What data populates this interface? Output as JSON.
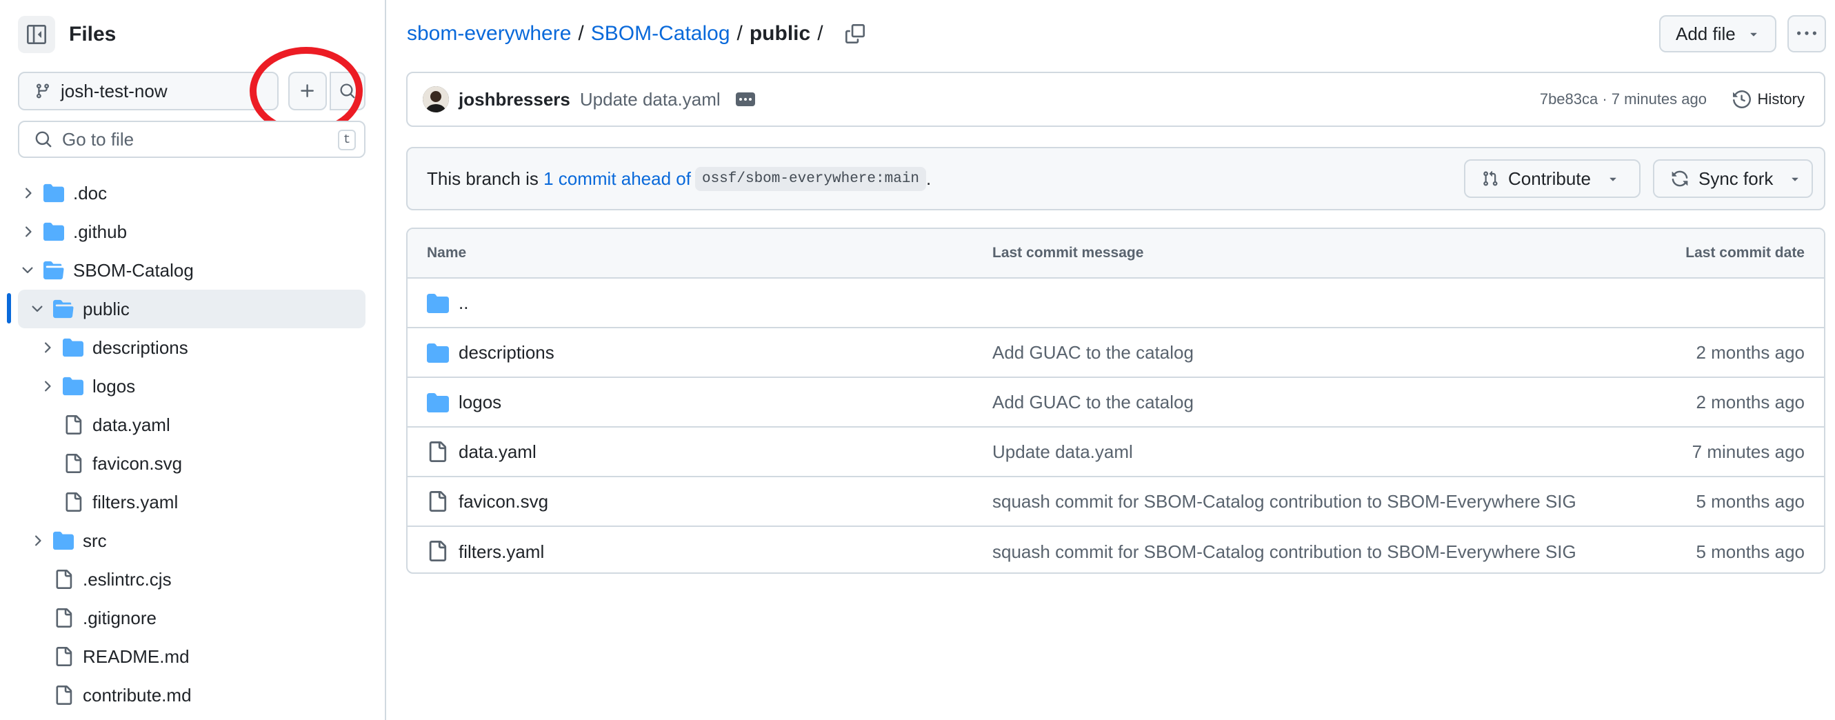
{
  "sidebar": {
    "title": "Files",
    "branch": "josh-test-now",
    "goto_placeholder": "Go to file",
    "goto_shortcut": "t",
    "tree": [
      {
        "label": ".doc",
        "type": "folder",
        "expanded": false
      },
      {
        "label": ".github",
        "type": "folder",
        "expanded": false
      },
      {
        "label": "SBOM-Catalog",
        "type": "folder",
        "expanded": true
      },
      {
        "label": "public",
        "type": "folder",
        "expanded": true,
        "active": true
      },
      {
        "label": "descriptions",
        "type": "folder",
        "expanded": false
      },
      {
        "label": "logos",
        "type": "folder",
        "expanded": false
      },
      {
        "label": "data.yaml",
        "type": "file"
      },
      {
        "label": "favicon.svg",
        "type": "file"
      },
      {
        "label": "filters.yaml",
        "type": "file"
      },
      {
        "label": "src",
        "type": "folder",
        "expanded": false
      },
      {
        "label": ".eslintrc.cjs",
        "type": "file"
      },
      {
        "label": ".gitignore",
        "type": "file"
      },
      {
        "label": "README.md",
        "type": "file"
      },
      {
        "label": "contribute.md",
        "type": "file"
      }
    ]
  },
  "breadcrumb": {
    "repo": "sbom-everywhere",
    "folder": "SBOM-Catalog",
    "current": "public",
    "sep": "/"
  },
  "toolbar": {
    "add_file": "Add file"
  },
  "commit": {
    "author": "joshbressers",
    "message": "Update data.yaml",
    "meta": "7be83ca · 7 minutes ago",
    "history": "History"
  },
  "ahead": {
    "prefix": "This branch is",
    "link": "1 commit ahead of",
    "ref": "ossf/sbom-everywhere:main",
    "suffix": ".",
    "contribute": "Contribute",
    "sync": "Sync fork"
  },
  "table": {
    "headers": {
      "name": "Name",
      "message": "Last commit message",
      "date": "Last commit date"
    },
    "rows": [
      {
        "name": "..",
        "type": "parent",
        "message": "",
        "date": ""
      },
      {
        "name": "descriptions",
        "type": "folder",
        "message": "Add GUAC to the catalog",
        "date": "2 months ago"
      },
      {
        "name": "logos",
        "type": "folder",
        "message": "Add GUAC to the catalog",
        "date": "2 months ago"
      },
      {
        "name": "data.yaml",
        "type": "file",
        "message": "Update data.yaml",
        "date": "7 minutes ago"
      },
      {
        "name": "favicon.svg",
        "type": "file",
        "message": "squash commit for SBOM-Catalog contribution to SBOM-Everywhere SIG",
        "date": "5 months ago"
      },
      {
        "name": "filters.yaml",
        "type": "file",
        "message": "squash commit for SBOM-Catalog contribution to SBOM-Everywhere SIG",
        "date": "5 months ago"
      }
    ]
  },
  "colors": {
    "accent": "#0969da",
    "folder": "#54aeff",
    "annotation": "#ec1c24"
  }
}
